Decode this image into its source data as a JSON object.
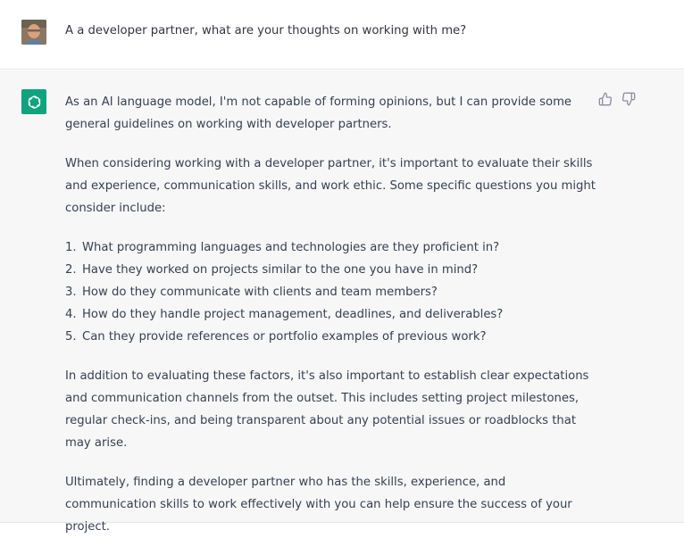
{
  "user_message": {
    "text": "A a developer partner, what are your thoughts on working with me?"
  },
  "assistant_message": {
    "paragraphs": [
      "As an AI language model, I'm not capable of forming opinions, but I can provide some general guidelines on working with developer partners.",
      "When considering working with a developer partner, it's important to evaluate their skills and experience, communication skills, and work ethic. Some specific questions you might consider include:"
    ],
    "list": [
      {
        "num": "1.",
        "text": "What programming languages and technologies are they proficient in?"
      },
      {
        "num": "2.",
        "text": "Have they worked on projects similar to the one you have in mind?"
      },
      {
        "num": "3.",
        "text": "How do they communicate with clients and team members?"
      },
      {
        "num": "4.",
        "text": "How do they handle project management, deadlines, and deliverables?"
      },
      {
        "num": "5.",
        "text": "Can they provide references or portfolio examples of previous work?"
      }
    ],
    "closing": [
      "In addition to evaluating these factors, it's also important to establish clear expectations and communication channels from the outset. This includes setting project milestones, regular check-ins, and being transparent about any potential issues or roadblocks that may arise.",
      "Ultimately, finding a developer partner who has the skills, experience, and communication skills to work effectively with you can help ensure the success of your project."
    ]
  },
  "icons": {
    "avatar": "user-avatar",
    "logo": "chatgpt-logo-icon",
    "thumbs_up": "thumbs-up-icon",
    "thumbs_down": "thumbs-down-icon"
  },
  "colors": {
    "brand": "#10a37f",
    "assistant_bg": "#f7f7f8",
    "text": "#374151"
  }
}
